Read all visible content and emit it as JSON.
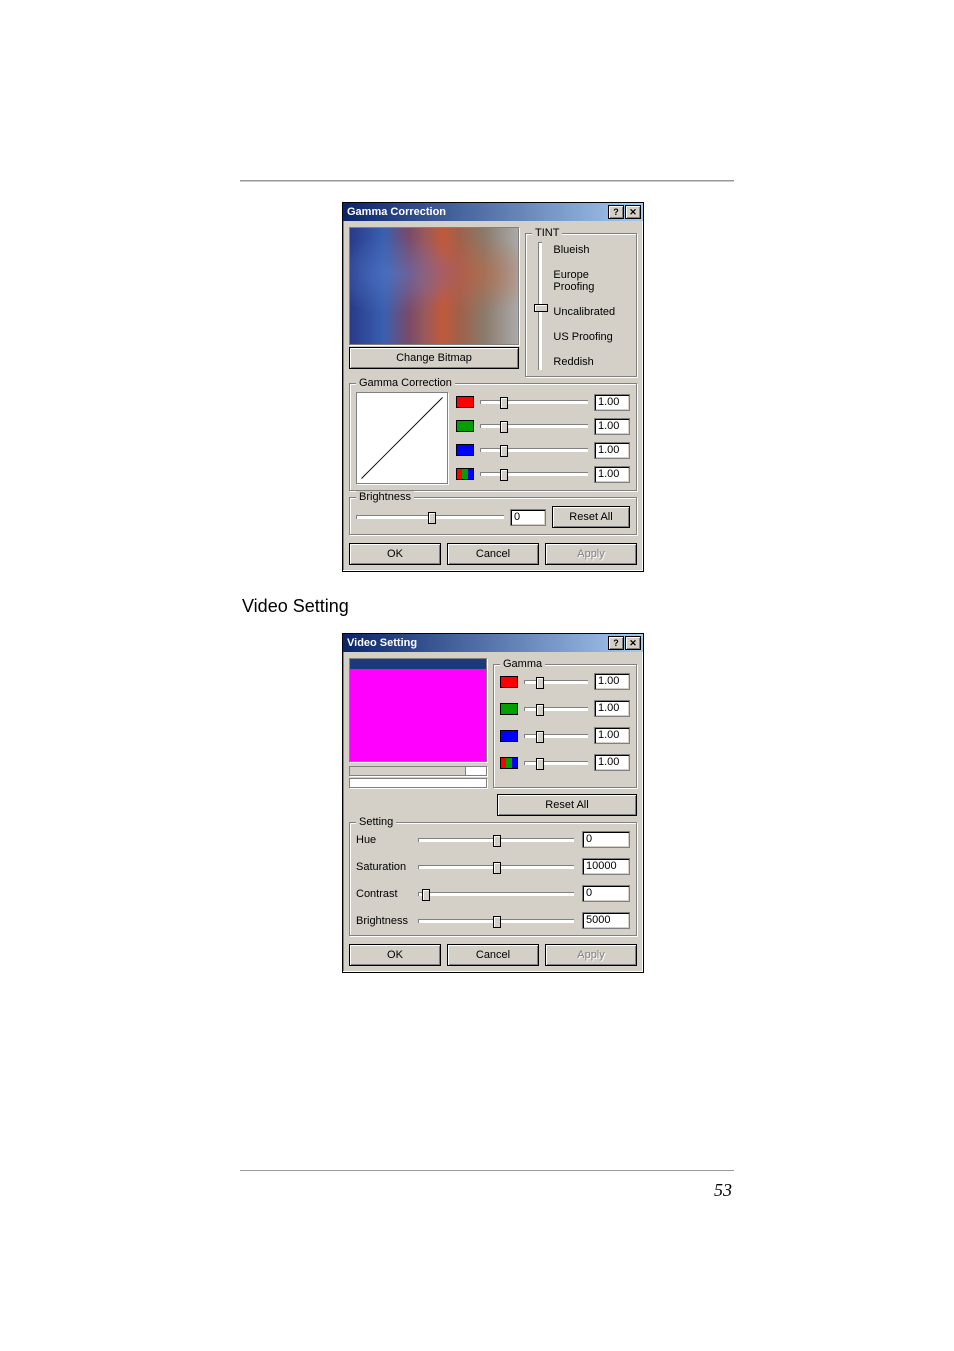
{
  "gamma_dialog": {
    "title": "Gamma Correction",
    "change_bitmap": "Change Bitmap",
    "tint": {
      "label": "TINT",
      "options": [
        "Blueish",
        "Europe Proofing",
        "Uncalibrated",
        "US Proofing",
        "Reddish"
      ]
    },
    "gamma_group_label": "Gamma Correction",
    "gamma_values": {
      "red": "1.00",
      "green": "1.00",
      "blue": "1.00",
      "all": "1.00"
    },
    "brightness": {
      "label": "Brightness",
      "value": "0"
    },
    "reset_all": "Reset All",
    "ok": "OK",
    "cancel": "Cancel",
    "apply": "Apply"
  },
  "video_heading": "Video Setting",
  "video_dialog": {
    "title": "Video Setting",
    "gamma_label": "Gamma",
    "gamma_values": {
      "red": "1.00",
      "green": "1.00",
      "blue": "1.00",
      "all": "1.00"
    },
    "reset_all": "Reset All",
    "setting_label": "Setting",
    "settings": {
      "hue": {
        "label": "Hue",
        "value": "0"
      },
      "saturation": {
        "label": "Saturation",
        "value": "10000"
      },
      "contrast": {
        "label": "Contrast",
        "value": "0"
      },
      "brightness": {
        "label": "Brightness",
        "value": "5000"
      }
    },
    "ok": "OK",
    "cancel": "Cancel",
    "apply": "Apply"
  },
  "page_number": "53"
}
